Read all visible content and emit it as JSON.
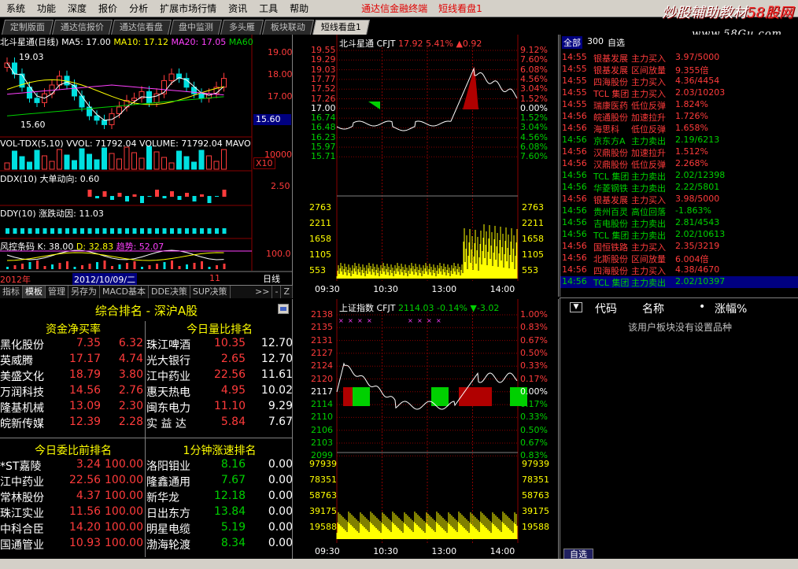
{
  "menubar": {
    "items": [
      "系统",
      "功能",
      "深度",
      "报价",
      "分析",
      "扩展市场行情",
      "资讯",
      "工具",
      "帮助"
    ],
    "highlights": [
      "通达信金融终端",
      "短线看盘1"
    ]
  },
  "brand": {
    "name_a": "炒股辅助教材",
    "name_b": "58股网",
    "url": "www.58Gu.com"
  },
  "tabs": [
    "定制版面",
    "通达信报价",
    "通达信看盘",
    "盘中监测",
    "多头雁",
    "板块联动",
    "短线看盘1"
  ],
  "kline": {
    "header": {
      "stock": "北斗星通(日线)",
      "ma5": "MA5: 17.00",
      "ma10": "MA10: 17.12",
      "ma20": "MA20: 17.05",
      "ma60": "MA60"
    },
    "high_label": "19.03",
    "low_label": "15.60",
    "axis": [
      "19.00",
      "18.00",
      "17.00"
    ],
    "cur": "15.60",
    "vol": {
      "title": "VOL-TDX(5,10)",
      "vol": "VVOL: 71792.04",
      "volume": "VOLUME: 71792.04",
      "mavol": "MAVO",
      "axis": "10000",
      "unit": "X10"
    },
    "ddx": {
      "title": "DDX(10)",
      "desc": "大单动向: 0.60",
      "axis": "2.50"
    },
    "ddy": {
      "title": "DDY(10)",
      "desc": "涨跌动因: 11.03"
    },
    "kd": {
      "title": "风控条码",
      "k": "K: 38.00",
      "d": "D: 32.83",
      "zt": "趋势: 52.07",
      "axis": "100.0"
    },
    "year": "2012年",
    "date": "2012/10/09/二",
    "period": "日线",
    "num": "11"
  },
  "left_tabs": [
    "指标",
    "模板",
    "管理",
    "另存为",
    "MACD基本",
    "DDE决策",
    "SUP决策",
    ">>",
    "-",
    "Z"
  ],
  "intraday1": {
    "name": "北斗星通",
    "code": "CFJT",
    "price": "17.92",
    "pct": "5.41%",
    "chg": "▲0.92",
    "prices": [
      "19.55",
      "19.29",
      "19.03",
      "18.77",
      "18.52",
      "18.26",
      "18.00",
      "17.74",
      "17.48",
      "17.22",
      "16.97",
      "16.71",
      "16.45",
      "16.19"
    ],
    "left_prices": [
      "19.55",
      "19.29",
      "19.03",
      "17.77",
      "17.52",
      "17.26",
      "17.00",
      "16.74",
      "16.48",
      "16.23",
      "15.97",
      "15.71"
    ],
    "pcts": [
      "9.12%",
      "7.60%",
      "6.08%",
      "4.56%",
      "3.04%",
      "1.52%",
      "0.00%",
      "1.52%",
      "3.04%",
      "4.56%",
      "6.08%",
      "7.60%"
    ],
    "vol_axis": [
      "2763",
      "2211",
      "1658",
      "1105",
      "553"
    ],
    "times": [
      "09:30",
      "10:30",
      "13:00",
      "14:00"
    ]
  },
  "intraday2": {
    "name": "上证指数",
    "code": "CFJT",
    "price": "2114.03",
    "pct": "-0.14%",
    "chg": "▼-3.02",
    "prices": [
      "2138",
      "2135",
      "2131",
      "2127",
      "2124",
      "2120",
      "2117",
      "2114",
      "2110",
      "2106",
      "2103",
      "2099"
    ],
    "pcts": [
      "1.00%",
      "0.83%",
      "0.67%",
      "0.50%",
      "0.33%",
      "0.17%",
      "0.00%",
      "0.17%",
      "0.33%",
      "0.50%",
      "0.67%",
      "0.83%"
    ],
    "vol_axis": [
      "97939",
      "78351",
      "58763",
      "39175",
      "19588"
    ],
    "times": [
      "09:30",
      "10:30",
      "13:00",
      "14:00"
    ]
  },
  "ranking": {
    "title": "综合排名 - 深沪A股",
    "tables": [
      {
        "title": "资金净买率",
        "rows": [
          [
            "黑化股份",
            "7.35",
            "6.32"
          ],
          [
            "英威腾",
            "17.17",
            "4.74"
          ],
          [
            "美盛文化",
            "18.79",
            "3.80"
          ],
          [
            "万润科技",
            "14.56",
            "2.76"
          ],
          [
            "隆基机械",
            "13.09",
            "2.30"
          ],
          [
            "皖新传媒",
            "12.39",
            "2.28"
          ]
        ]
      },
      {
        "title": "今日量比排名",
        "rows": [
          [
            "珠江啤酒",
            "10.35",
            "12.70"
          ],
          [
            "光大银行",
            "2.65",
            "12.70"
          ],
          [
            "江中药业",
            "22.56",
            "11.61"
          ],
          [
            "惠天热电",
            "4.95",
            "10.02"
          ],
          [
            "闽东电力",
            "11.10",
            "9.29"
          ],
          [
            "实 益 达",
            "5.84",
            "7.67"
          ]
        ]
      },
      {
        "title": "今日委比前排名",
        "rows": [
          [
            "*ST嘉陵",
            "3.24",
            "100.00"
          ],
          [
            "江中药业",
            "22.56",
            "100.00"
          ],
          [
            "常林股份",
            "4.37",
            "100.00"
          ],
          [
            "珠江实业",
            "11.56",
            "100.00"
          ],
          [
            "中科合臣",
            "14.20",
            "100.00"
          ],
          [
            "国通管业",
            "10.93",
            "100.00"
          ]
        ]
      },
      {
        "title": "1分钟涨速排名",
        "rows": [
          [
            "洛阳钼业",
            "8.16",
            "0.00"
          ],
          [
            "隆鑫通用",
            "7.67",
            "0.00"
          ],
          [
            "新华龙",
            "12.18",
            "0.00"
          ],
          [
            "日出东方",
            "13.84",
            "0.00"
          ],
          [
            "明星电缆",
            "5.19",
            "0.00"
          ],
          [
            "渤海轮渡",
            "8.34",
            "0.00"
          ]
        ]
      }
    ]
  },
  "ticker": {
    "head": [
      "全部",
      "300",
      "自选"
    ],
    "rows": [
      [
        "14:55",
        "银基发展",
        "主力买入",
        "3.97/5000",
        "r"
      ],
      [
        "14:55",
        "银基发展",
        "区间放量",
        "9.355倍",
        "r"
      ],
      [
        "14:55",
        "四海股份",
        "主力买入",
        "4.36/4454",
        "r"
      ],
      [
        "14:55",
        "TCL 集团",
        "主力买入",
        "2.03/10203",
        "r"
      ],
      [
        "14:55",
        "瑞康医药",
        "低位反弹",
        "1.824%",
        "r"
      ],
      [
        "14:56",
        "皖通股份",
        "加速拉升",
        "1.726%",
        "r"
      ],
      [
        "14:56",
        "海思科",
        "低位反弹",
        "1.658%",
        "r"
      ],
      [
        "14:56",
        "京东方A",
        "主力卖出",
        "2.19/6213",
        "g"
      ],
      [
        "14:56",
        "汉鼎股份",
        "加速拉升",
        "1.512%",
        "r"
      ],
      [
        "14:56",
        "汉鼎股份",
        "低位反弹",
        "2.268%",
        "r"
      ],
      [
        "14:56",
        "TCL 集团",
        "主力卖出",
        "2.02/12398",
        "g"
      ],
      [
        "14:56",
        "华菱钢铁",
        "主力卖出",
        "2.22/5801",
        "g"
      ],
      [
        "14:56",
        "银基发展",
        "主力买入",
        "3.98/5000",
        "r"
      ],
      [
        "14:56",
        "贵州百灵",
        "高位回落",
        "-1.863%",
        "g"
      ],
      [
        "14:56",
        "吉电股份",
        "主力卖出",
        "2.81/4543",
        "g"
      ],
      [
        "14:56",
        "TCL 集团",
        "主力卖出",
        "2.02/10613",
        "g"
      ],
      [
        "14:56",
        "国恒铁路",
        "主力买入",
        "2.35/3219",
        "r"
      ],
      [
        "14:56",
        "北斯股份",
        "区间放量",
        "6.004倍",
        "r"
      ],
      [
        "14:56",
        "四海股份",
        "主力买入",
        "4.38/4670",
        "r"
      ],
      [
        "14:56",
        "TCL 集团",
        "主力卖出",
        "2.02/10397",
        "g"
      ]
    ]
  },
  "watch": {
    "headers": [
      "代码",
      "名称",
      "•",
      "涨幅%"
    ],
    "empty": "该用户板块没有设置品种",
    "tab": "自选"
  },
  "colors": {
    "up": "#ff3b3b",
    "down": "#00d000",
    "grid": "#8a0000",
    "bg": "#000000"
  }
}
